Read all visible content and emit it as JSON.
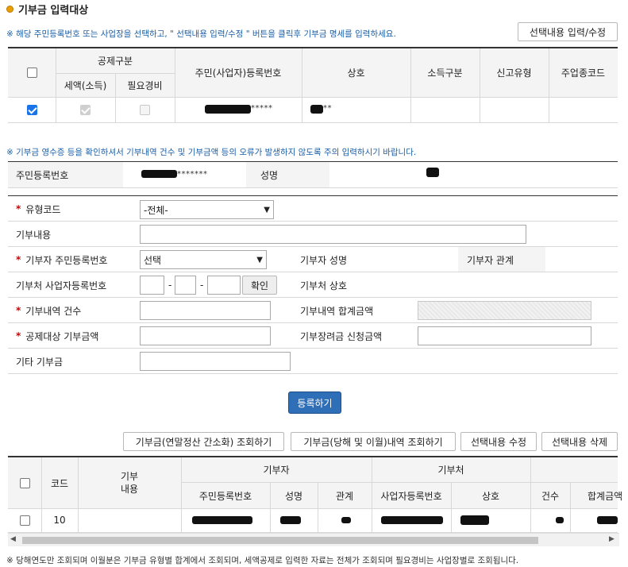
{
  "section_title": "기부금 입력대상",
  "note1": "※ 해당 주민등록번호 또는 사업장을 선택하고, \" 선택내용 입력/수정 \" 버튼을 클릭후 기부금 명세를 입력하세요.",
  "btn_select_edit": "선택내용 입력/수정",
  "target_table": {
    "group_header": "공제구분",
    "sub_headers": [
      "세액(소득)",
      "필요경비"
    ],
    "headers": [
      "주민(사업자)등록번호",
      "상호",
      "소득구분",
      "신고유형",
      "주업종코드"
    ],
    "row": {
      "id_mask": "*****",
      "name_mask": "**"
    }
  },
  "note2": "※ 기부금 영수증 등을 확인하셔서 기부내역 건수 및 기부금액 등의 오류가 발생하지 않도록 주의 입력하시기 바랍니다.",
  "info": {
    "resident_label": "주민등록번호",
    "resident_mask": "*******",
    "name_label": "성명"
  },
  "form": {
    "type_code_label": "유형코드",
    "type_code_value": "-전체-",
    "content_label": "기부내용",
    "donor_id_label": "기부자 주민등록번호",
    "donor_id_value": "선택",
    "donor_name_label": "기부자 성명",
    "donor_rel_label": "기부자 관계",
    "org_bizno_label": "기부처 사업자등록번호",
    "dash": "-",
    "confirm_btn": "확인",
    "org_name_label": "기부처 상호",
    "count_label": "기부내역 건수",
    "total_label": "기부내역 합계금액",
    "deduct_label": "공제대상 기부금액",
    "scholarship_label": "기부장려금 신청금액",
    "other_label": "기타 기부금"
  },
  "register_btn": "등록하기",
  "actions": [
    "기부금(연말정산 간소화) 조회하기",
    "기부금(당해 및 이월)내역 조회하기",
    "선택내용 수정",
    "선택내용 삭제"
  ],
  "list_table": {
    "code_header": "코드",
    "content_header": "기부\n내용",
    "donor_group": "기부자",
    "org_group": "기부처",
    "donor_cols": [
      "주민등록번호",
      "성명",
      "관계"
    ],
    "org_cols": [
      "사업자등록번호",
      "상호"
    ],
    "tail_cols": [
      "건수",
      "합계금액"
    ],
    "row": {
      "code": "10"
    }
  },
  "footer_note": "※ 당해연도만 조회되며 이월분은 기부금 유형별 합계에서 조회되며, 세액공제로 입력한 자료는 전체가 조회되며 필요경비는 사업장별로 조회됩니다."
}
